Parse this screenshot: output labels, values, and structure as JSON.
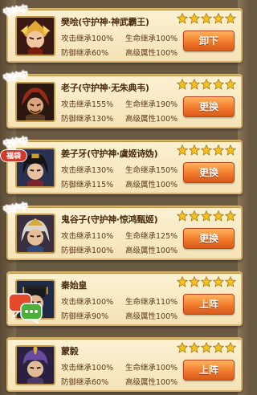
{
  "stat_labels": {
    "attack": "攻击继承",
    "hp": "生命继承",
    "defense": "防御继承",
    "advanced": "高级属性"
  },
  "guard_tag": "守护中",
  "badge": "福袋",
  "colors": {
    "star_filled": "#f7c21a",
    "button": "#f17a2c",
    "card": "#f4e3b6",
    "tag": "#e6301f"
  },
  "heroes": [
    {
      "name": "樊哙(守护神·神武霸王)",
      "guarding": true,
      "stars": 5,
      "attack": "100%",
      "hp": "100%",
      "defense": "60%",
      "advanced": "100%",
      "button": "卸下",
      "portrait": "warrior-gold-helmet"
    },
    {
      "name": "老子(守护神·无朱典韦)",
      "guarding": true,
      "stars": 5,
      "attack": "155%",
      "hp": "190%",
      "defense": "130%",
      "advanced": "100%",
      "button": "更换",
      "portrait": "warrior-red-hair"
    },
    {
      "name": "姜子牙(守护神·虞姬诗妫)",
      "guarding": true,
      "stars": 5,
      "attack": "130%",
      "hp": "150%",
      "defense": "115%",
      "advanced": "100%",
      "button": "更换",
      "portrait": "sage-black-hair"
    },
    {
      "name": "鬼谷子(守护神·惊鸿甄姬)",
      "guarding": true,
      "stars": 5,
      "attack": "110%",
      "hp": "125%",
      "defense": "100%",
      "advanced": "100%",
      "button": "更换",
      "portrait": "strategist-silver-hair"
    },
    {
      "name": "秦始皇",
      "guarding": false,
      "stars": 5,
      "attack": "100%",
      "hp": "110%",
      "defense": "90%",
      "advanced": "100%",
      "button": "上阵",
      "portrait": "emperor-crown"
    },
    {
      "name": "蒙毅",
      "guarding": false,
      "stars": 5,
      "attack": "100%",
      "hp": "100%",
      "defense": "60%",
      "advanced": "100%",
      "button": "上阵",
      "portrait": "general-purple-helmet"
    }
  ]
}
